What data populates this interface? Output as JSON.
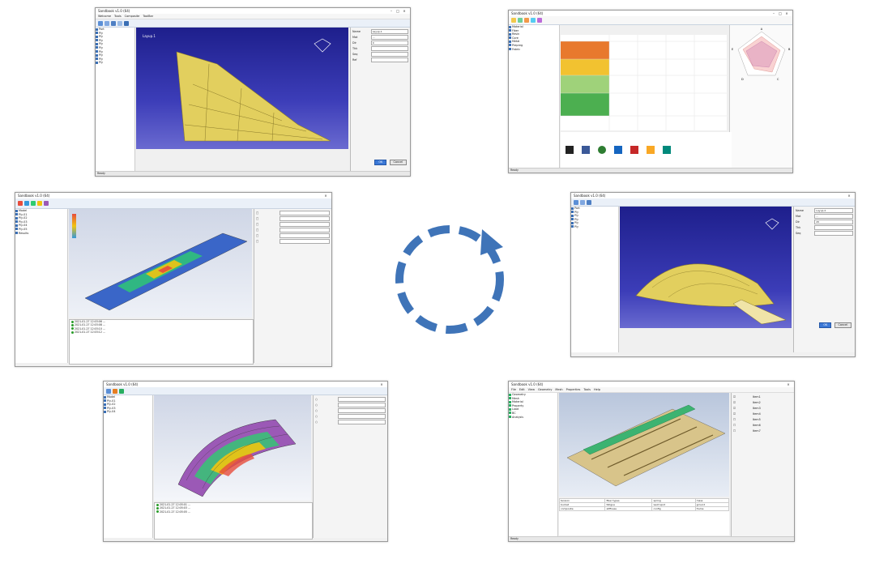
{
  "app_title": "Sandbook",
  "windows": {
    "w1": {
      "title": "Sandbook v1.0 (64)",
      "menu": [
        "Welcome",
        "Tools",
        "Composite",
        "ToolBar"
      ],
      "props": [
        {
          "label": "Name",
          "value": "Layup.1"
        },
        {
          "label": "Mat",
          "value": "..."
        },
        {
          "label": "Dir",
          "value": "0"
        },
        {
          "label": "Thk",
          "value": ""
        },
        {
          "label": "Seq",
          "value": ""
        },
        {
          "label": "Ref",
          "value": ""
        }
      ],
      "ok": "OK",
      "cancel": "Cancel",
      "status": "Ready"
    },
    "w2": {
      "title": "Sandbook v1.0 (64)",
      "radar_labels": [
        "A",
        "B",
        "C",
        "D",
        "E"
      ],
      "status": "Ready"
    },
    "w3": {
      "title": "Sandbook v1.0 (64)",
      "log": [
        "2021-01-27 12:03:06 ...",
        "2021-01-27 12:03:08 ...",
        "2021-01-27 12:03:10 ...",
        "2021-01-27 12:03:12 ..."
      ]
    },
    "w4": {
      "title": "Sandbook v1.0 (64)",
      "props": [
        {
          "label": "Name",
          "value": "Layup.2"
        },
        {
          "label": "Mat",
          "value": "..."
        },
        {
          "label": "Dir",
          "value": "45"
        },
        {
          "label": "Thk",
          "value": ""
        },
        {
          "label": "Seq",
          "value": ""
        }
      ],
      "ok": "OK",
      "cancel": "Cancel"
    },
    "w5": {
      "title": "Sandbook v1.0 (64)",
      "log": [
        "2021-01-27 12:05:01 ...",
        "2021-01-27 12:05:03 ...",
        "2021-01-27 12:05:05 ..."
      ]
    },
    "w6": {
      "title": "Sandbook v1.0 (64)",
      "menu": [
        "File",
        "Edit",
        "View",
        "Geometry",
        "Mesh",
        "Properties",
        "Tools",
        "Help"
      ],
      "table_words": [
        "tension",
        "fiber types",
        "spring",
        "mass",
        "bucket",
        "fatigue",
        "weld spot",
        "ground",
        "composite",
        "stiffness",
        "config",
        "frame"
      ],
      "check_items": [
        "Item1",
        "Item2",
        "Item3",
        "Item4",
        "Item5",
        "Item6",
        "Item7"
      ],
      "status": "Ready"
    }
  },
  "colors": {
    "accent": "#3b78d6",
    "cycle_arrow": "#3f74b8",
    "viewport_blue": "#1c1e86",
    "surface_yellow": "#e8d46a"
  }
}
